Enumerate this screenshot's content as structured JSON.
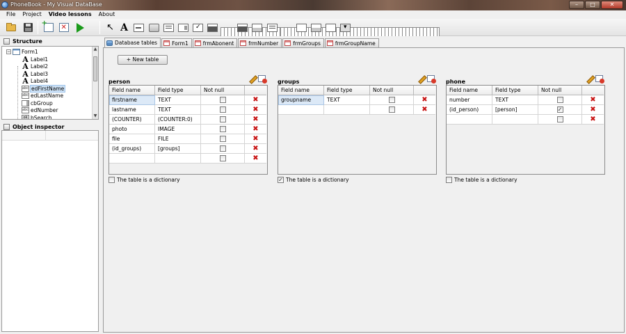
{
  "window": {
    "title": "PhoneBook - My Visual DataBase",
    "minimize_glyph": "–",
    "maximize_glyph": "□",
    "close_glyph": "✕"
  },
  "menu": [
    "File",
    "Project",
    "Video lessons",
    "About"
  ],
  "toolbar": {
    "icons": [
      "open-folder-icon",
      "save-icon",
      "new-form-icon",
      "delete-form-icon",
      "run-icon",
      "pointer-icon",
      "label-icon",
      "edit-icon",
      "memo-icon",
      "combobox-icon",
      "checkbox-icon",
      "groupbox-icon",
      "grid-icon",
      "panel-icon",
      "tabs-icon",
      "shape-icon",
      "form-icon",
      "dropdown-icon"
    ],
    "pointer_glyph": "↖",
    "label_glyph": "A"
  },
  "structure": {
    "title": "Structure",
    "expander_glyph": "−",
    "items": [
      {
        "label": "Form1",
        "type": "form",
        "level": 0
      },
      {
        "label": "Label1",
        "type": "label",
        "level": 1
      },
      {
        "label": "Label2",
        "type": "label",
        "level": 1
      },
      {
        "label": "Label3",
        "type": "label",
        "level": 1
      },
      {
        "label": "Label4",
        "type": "label",
        "level": 1
      },
      {
        "label": "edFirstName",
        "type": "edit",
        "level": 1,
        "selected": true
      },
      {
        "label": "edLastName",
        "type": "edit",
        "level": 1
      },
      {
        "label": "cbGroup",
        "type": "combo",
        "level": 1
      },
      {
        "label": "edNumber",
        "type": "edit",
        "level": 1
      },
      {
        "label": "bSearch",
        "type": "button",
        "level": 1
      }
    ],
    "node_glyphs": {
      "label": "A",
      "edit": "abc",
      "button": "ok"
    },
    "scroll_up_glyph": "▲",
    "scroll_down_glyph": "▼"
  },
  "inspector": {
    "title": "Object inspector"
  },
  "tabs": [
    {
      "label": "Database tables",
      "icon": "database-icon",
      "active": true
    },
    {
      "label": "Form1",
      "icon": "form-icon"
    },
    {
      "label": "frmAbonent",
      "icon": "form-icon"
    },
    {
      "label": "frmNumber",
      "icon": "form-icon"
    },
    {
      "label": "frmGroups",
      "icon": "form-icon"
    },
    {
      "label": "frmGroupName",
      "icon": "form-icon"
    }
  ],
  "new_table_label": "+ New table",
  "columns": {
    "field": "Field name",
    "type": "Field type",
    "notnull": "Not null"
  },
  "delete_glyph": "✖",
  "check_glyph": "✓",
  "dictionary_label": "The table is a dictionary",
  "tables": [
    {
      "name": "person",
      "is_dictionary": false,
      "rows": [
        {
          "field": "firstname",
          "type": "TEXT",
          "notnull": false,
          "selected": true
        },
        {
          "field": "lastname",
          "type": "TEXT",
          "notnull": false
        },
        {
          "field": "(COUNTER)",
          "type": "(COUNTER:0)",
          "notnull": false
        },
        {
          "field": "photo",
          "type": "IMAGE",
          "notnull": false
        },
        {
          "field": "file",
          "type": "FILE",
          "notnull": false
        },
        {
          "field": "(id_groups)",
          "type": "[groups]",
          "notnull": false
        },
        {
          "field": "",
          "type": "",
          "notnull": false
        }
      ]
    },
    {
      "name": "groups",
      "is_dictionary": true,
      "rows": [
        {
          "field": "groupname",
          "type": "TEXT",
          "notnull": false,
          "selected": true
        },
        {
          "field": "",
          "type": "",
          "notnull": false
        }
      ]
    },
    {
      "name": "phone",
      "is_dictionary": false,
      "rows": [
        {
          "field": "number",
          "type": "TEXT",
          "notnull": false
        },
        {
          "field": "(id_person)",
          "type": "[person]",
          "notnull": true
        },
        {
          "field": "",
          "type": "",
          "notnull": false
        }
      ]
    }
  ]
}
